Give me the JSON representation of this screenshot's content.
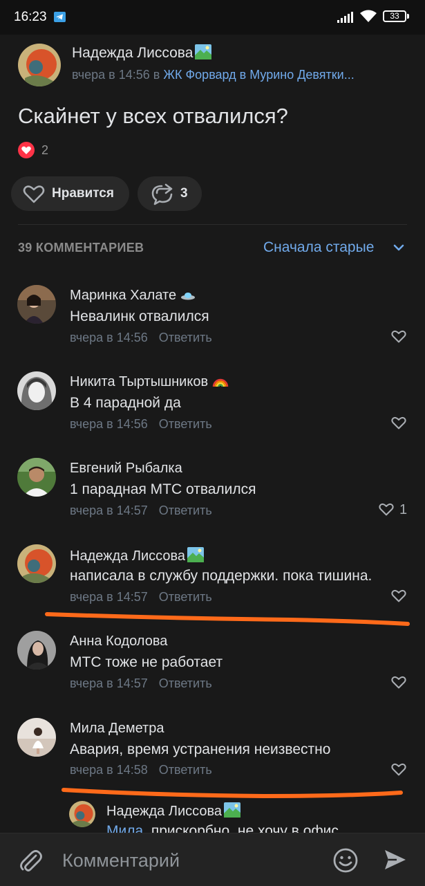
{
  "status_bar": {
    "time": "16:23",
    "battery": "33",
    "icons": [
      "telegram-icon",
      "signal-icon",
      "wifi-icon",
      "battery-icon"
    ]
  },
  "post": {
    "author": "Надежда Лиссова",
    "time": "вчера в 14:56",
    "in_word": "в",
    "group": "ЖК Форвард в Мурино Девятки...",
    "text": "Скайнет у всех отвалился?",
    "likes_count": "2",
    "like_button": "Нравится",
    "share_count": "3"
  },
  "comments_header": {
    "count_label": "39 КОММЕНТАРИЕВ",
    "sort_label": "Сначала старые"
  },
  "comments": [
    {
      "name": "Маринка Халате",
      "text": "Невалинк отвалился",
      "time": "вчера в 14:56",
      "reply": "Ответить",
      "likes": ""
    },
    {
      "name": "Никита Тыртышников",
      "text": "В 4 парадной да",
      "time": "вчера в 14:56",
      "reply": "Ответить",
      "likes": ""
    },
    {
      "name": "Евгений Рыбалка",
      "text": "1 парадная МТС отвалился",
      "time": "вчера в 14:57",
      "reply": "Ответить",
      "likes": "1"
    },
    {
      "name": "Надежда Лиссова",
      "text": "написала в службу поддержки. пока тишина.",
      "time": "вчера в 14:57",
      "reply": "Ответить",
      "likes": ""
    },
    {
      "name": "Анна Кодолова",
      "text": "МТС тоже не работает",
      "time": "вчера в 14:57",
      "reply": "Ответить",
      "likes": ""
    },
    {
      "name": "Мила Деметра",
      "text": "Авария, время устранения неизвестно",
      "time": "вчера в 14:58",
      "reply": "Ответить",
      "likes": ""
    }
  ],
  "nested_reply": {
    "name": "Надежда Лиссова",
    "mention": "Мила",
    "text": ", прискорбно, не хочу в офис"
  },
  "composer": {
    "placeholder": "Комментарий"
  },
  "colors": {
    "background": "#191919",
    "accent": "#71aaeb",
    "like_red": "#ff3347",
    "annotation_orange": "#ff6a1a"
  }
}
